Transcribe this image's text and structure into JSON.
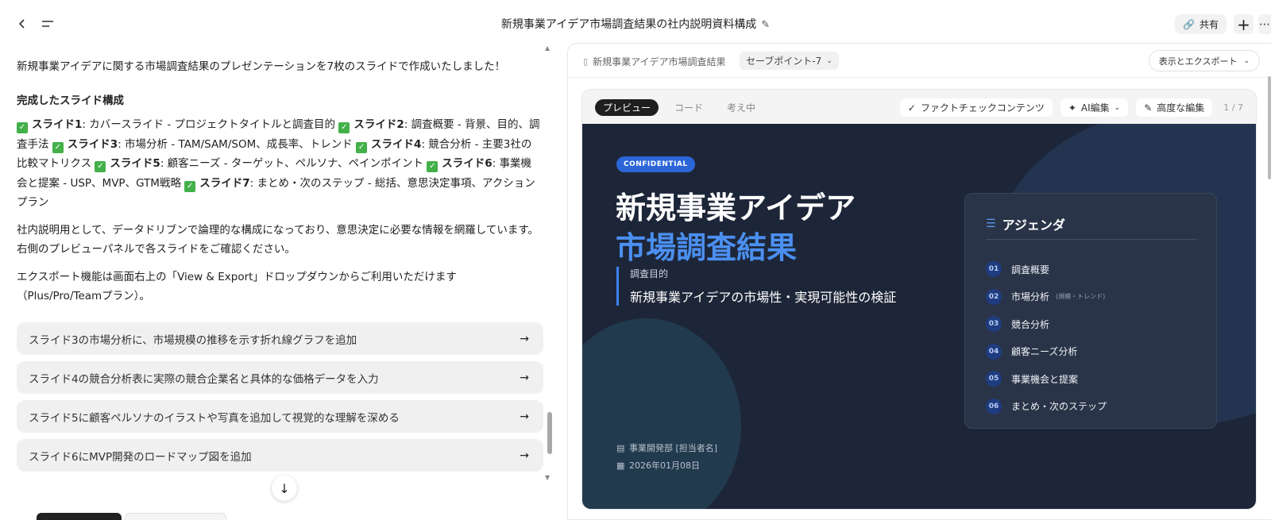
{
  "header": {
    "title": "新規事業アイデア市場調査結果の社内説明資料構成",
    "share_label": "共有"
  },
  "chat": {
    "intro": "新規事業アイデアに関する市場調査結果のプレゼンテーションを7枚のスライドで作成いたしました！",
    "section_heading": "完成したスライド構成",
    "slides": [
      {
        "name": "スライド1",
        "desc": ": カバースライド - プロジェクトタイトルと調査目的"
      },
      {
        "name": "スライド2",
        "desc": ": 調査概要 - 背景、目的、調査手法"
      },
      {
        "name": "スライド3",
        "desc": ": 市場分析 - TAM/SAM/SOM、成長率、トレンド"
      },
      {
        "name": "スライド4",
        "desc": ": 競合分析 - 主要3社の比較マトリクス"
      },
      {
        "name": "スライド5",
        "desc": ": 顧客ニーズ - ターゲット、ペルソナ、ペインポイント"
      },
      {
        "name": "スライド6",
        "desc": ": 事業機会と提案 - USP、MVP、GTM戦略"
      },
      {
        "name": "スライド7",
        "desc": ": まとめ・次のステップ - 総括、意思決定事項、アクションプラン"
      }
    ],
    "para2": "社内説明用として、データドリブンで論理的な構成になっており、意思決定に必要な情報を網羅しています。右側のプレビューパネルで各スライドをご確認ください。",
    "para3": "エクスポート機能は画面右上の「View & Export」ドロップダウンからご利用いただけます（Plus/Pro/Teamプラン）。",
    "suggestions": [
      "スライド3の市場分析に、市場規模の推移を示す折れ線グラフを追加",
      "スライド4の競合分析表に実際の競合企業名と具体的な価格データを入力",
      "スライド5に顧客ペルソナのイラストや写真を追加して視覚的な理解を深める",
      "スライド6にMVP開発のロードマップ図を追加"
    ]
  },
  "panel": {
    "doc_name": "新規事業アイデア市場調査結果",
    "savepoint": "セーブポイント-7",
    "export_label": "表示とエクスポート",
    "tabs": [
      "プレビュー",
      "コード",
      "考え中"
    ],
    "tools": {
      "factcheck": "ファクトチェックコンテンツ",
      "ai_edit": "AI編集",
      "advanced_edit": "高度な編集"
    },
    "page": "1 / 7"
  },
  "slide": {
    "badge": "CONFIDENTIAL",
    "title_line1": "新規事業アイデア",
    "title_line2": "市場調査結果",
    "purpose_label": "調査目的",
    "purpose_text": "新規事業アイデアの市場性・実現可能性の検証",
    "department": "事業開発部 [担当者名]",
    "date": "2026年01月08日",
    "agenda_title": "アジェンダ",
    "agenda": [
      {
        "num": "01",
        "label": "調査概要",
        "note": ""
      },
      {
        "num": "02",
        "label": "市場分析",
        "note": "(規模・トレンド)"
      },
      {
        "num": "03",
        "label": "競合分析",
        "note": ""
      },
      {
        "num": "04",
        "label": "顧客ニーズ分析",
        "note": ""
      },
      {
        "num": "05",
        "label": "事業機会と提案",
        "note": ""
      },
      {
        "num": "06",
        "label": "まとめ・次のステップ",
        "note": ""
      }
    ]
  },
  "colors": {
    "slide_bg": "#1d2638",
    "accent_blue": "#4b8ff0",
    "badge_blue": "#2b66d9"
  }
}
